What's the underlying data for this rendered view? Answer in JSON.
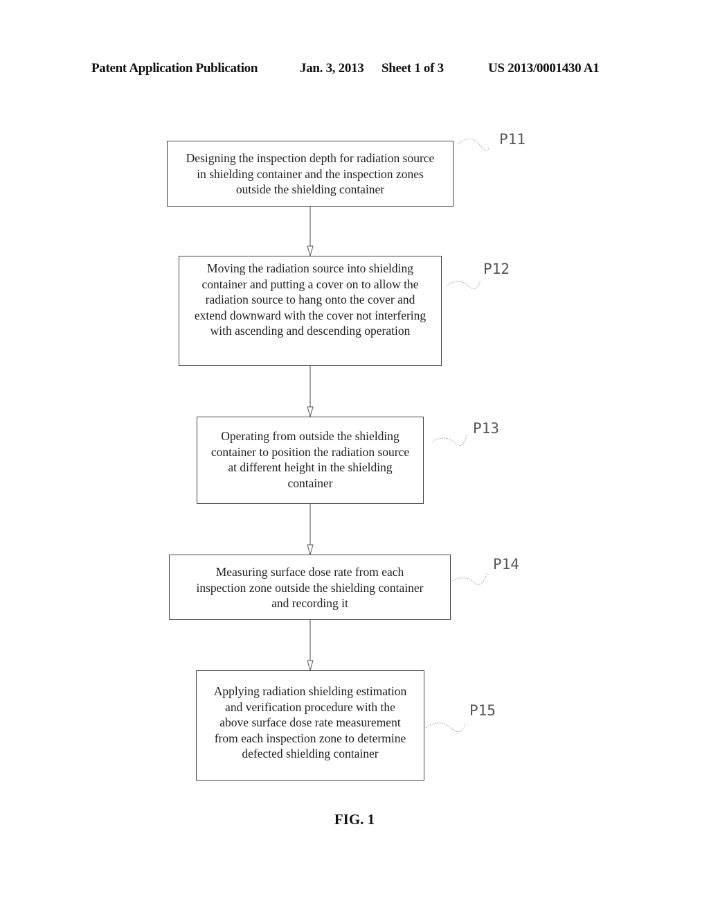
{
  "header": {
    "publication_type": "Patent Application Publication",
    "date": "Jan. 3, 2013",
    "sheet": "Sheet 1 of 3",
    "publication_number": "US 2013/0001430 A1"
  },
  "flowchart": {
    "steps": [
      {
        "id": "P11",
        "text": "Designing the inspection depth for radiation source in shielding container and the inspection zones outside the shielding container",
        "lines": [
          "Designing the inspection depth for radiation source",
          "in shielding container and the inspection zones",
          "outside the shielding container"
        ]
      },
      {
        "id": "P12",
        "text": "Moving the radiation source into shielding container and putting a cover on to allow the radiation source to hang onto the cover and extend downward with the cover not interfering with ascending and descending operation",
        "lines": [
          "Moving the radiation source into shielding",
          "container and putting a cover on to allow the",
          "radiation source to hang onto the cover and",
          "extend downward with the cover not interfering",
          "with ascending and descending operation"
        ]
      },
      {
        "id": "P13",
        "text": "Operating from outside the shielding container to position the radiation source at different height in the shielding container",
        "lines": [
          "Operating from outside the shielding",
          "container to position the radiation source",
          "at different height in the shielding",
          "container"
        ]
      },
      {
        "id": "P14",
        "text": "Measuring surface dose rate from each inspection zone outside the shielding container and recording it",
        "lines": [
          "Measuring surface dose rate from each",
          "inspection zone outside the shielding container",
          "and recording it"
        ]
      },
      {
        "id": "P15",
        "text": "Applying radiation shielding estimation and verification procedure with the above surface dose rate measurement from each inspection zone to determine defected shielding container",
        "lines": [
          "Applying radiation shielding estimation",
          "and verification procedure with the",
          "above surface dose rate measurement",
          "from each inspection zone to determine",
          "defected shielding container"
        ]
      }
    ],
    "connections": [
      [
        "P11",
        "P12"
      ],
      [
        "P12",
        "P13"
      ],
      [
        "P13",
        "P14"
      ],
      [
        "P14",
        "P15"
      ]
    ]
  },
  "figure_caption": "FIG. 1"
}
